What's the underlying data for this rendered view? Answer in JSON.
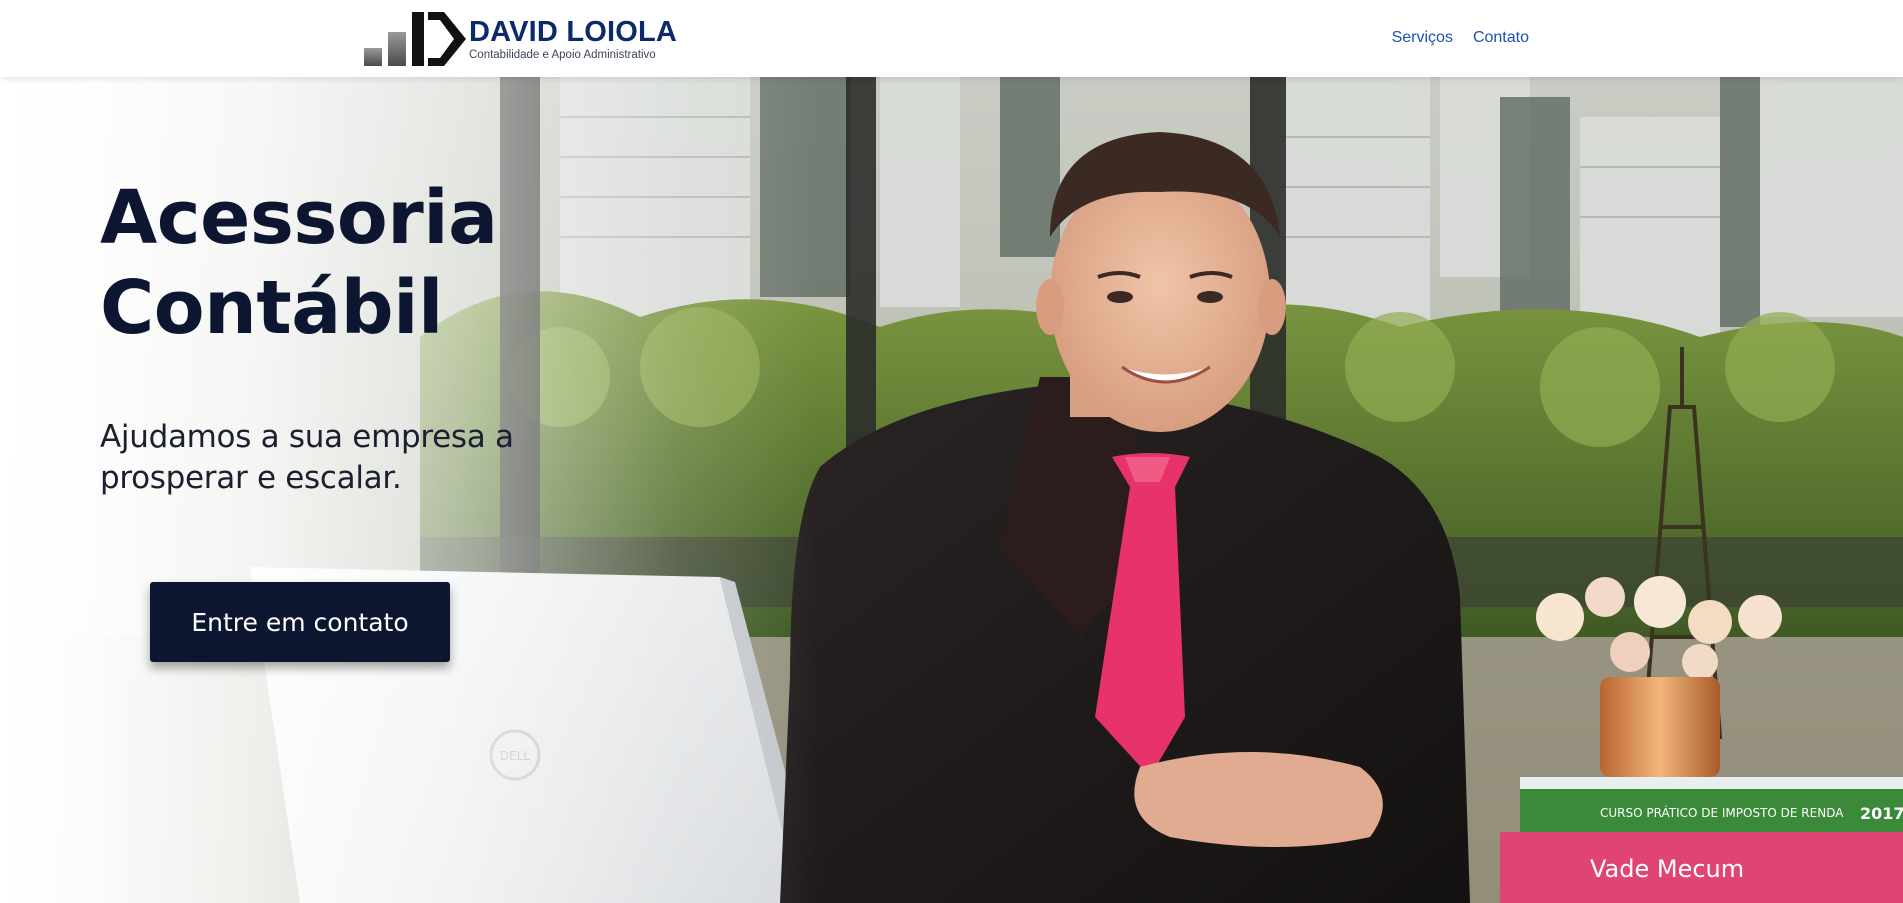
{
  "header": {
    "logo": {
      "name": "DAVID LOIOLA",
      "tagline": "Contabilidade e Apoio Administrativo",
      "icon": "bar-chart-d-logo-icon"
    },
    "nav": [
      {
        "label": "Serviços"
      },
      {
        "label": "Contato"
      }
    ]
  },
  "hero": {
    "title_line_1": "Acessoria",
    "title_line_2": "Contábil",
    "subtitle": "Ajudamos a sua empresa a prosperar e escalar.",
    "cta_label": "Entre em contato",
    "image": "professional-man-at-desk-photo",
    "image_laptop_brand": "DELL",
    "image_book_1": "CURSO PRÁTICO DE IMPOSTO DE RENDA",
    "image_book_1_year": "2017",
    "image_book_2": "Vade Mecum"
  },
  "colors": {
    "brand_navy": "#0d1631",
    "logo_blue": "#0c2a6b",
    "nav_link": "#1c4fb8",
    "tie_pink": "#e8336a"
  }
}
